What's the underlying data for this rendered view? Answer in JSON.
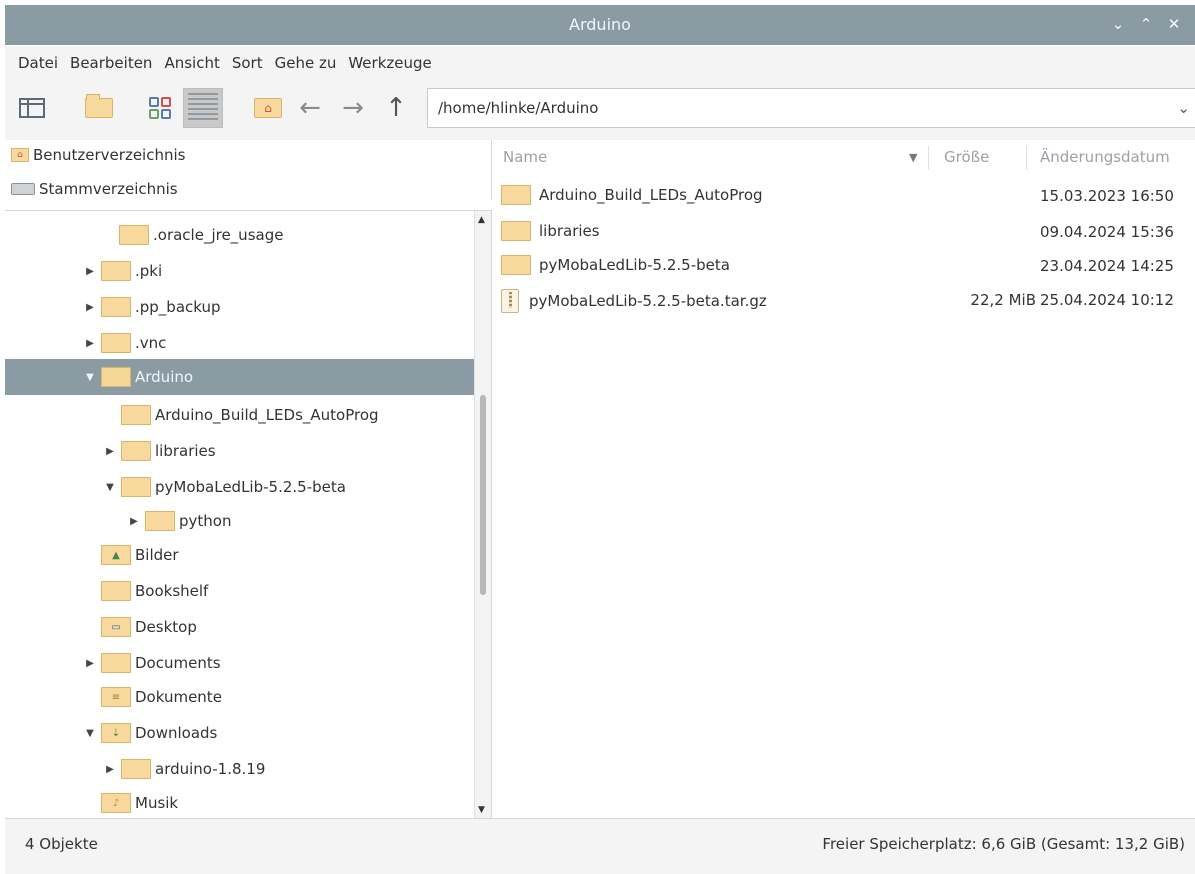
{
  "window": {
    "title": "Arduino"
  },
  "menu": [
    "Datei",
    "Bearbeiten",
    "Ansicht",
    "Sort",
    "Gehe zu",
    "Werkzeuge"
  ],
  "toolbar": {
    "path": "/home/hlinke/Arduino"
  },
  "places": [
    {
      "label": "Benutzerverzeichnis",
      "icon": "home-folder-icon"
    },
    {
      "label": "Stammverzeichnis",
      "icon": "drive-icon"
    }
  ],
  "tree": [
    {
      "label": ".oracle_jre_usage",
      "arrow": "",
      "selected": false
    },
    {
      "label": ".pki",
      "arrow": "▶",
      "selected": false
    },
    {
      "label": ".pp_backup",
      "arrow": "▶",
      "selected": false
    },
    {
      "label": ".vnc",
      "arrow": "▶",
      "selected": false
    },
    {
      "label": "Arduino",
      "arrow": "▼",
      "selected": true
    },
    {
      "label": "Arduino_Build_LEDs_AutoProg",
      "arrow": "",
      "selected": false
    },
    {
      "label": "libraries",
      "arrow": "▶",
      "selected": false
    },
    {
      "label": "pyMobaLedLib-5.2.5-beta",
      "arrow": "▼",
      "selected": false
    },
    {
      "label": "python",
      "arrow": "▶",
      "selected": false
    },
    {
      "label": "Bilder",
      "arrow": "",
      "selected": false
    },
    {
      "label": "Bookshelf",
      "arrow": "",
      "selected": false
    },
    {
      "label": "Desktop",
      "arrow": "",
      "selected": false
    },
    {
      "label": "Documents",
      "arrow": "▶",
      "selected": false
    },
    {
      "label": "Dokumente",
      "arrow": "",
      "selected": false
    },
    {
      "label": "Downloads",
      "arrow": "▼",
      "selected": false
    },
    {
      "label": "arduino-1.8.19",
      "arrow": "▶",
      "selected": false
    },
    {
      "label": "Musik",
      "arrow": "",
      "selected": false
    }
  ],
  "columns": {
    "name": "Name",
    "size": "Größe",
    "date": "Änderungsdatum"
  },
  "files": [
    {
      "name": "Arduino_Build_LEDs_AutoProg",
      "size": "",
      "date": "15.03.2023 16:50",
      "kind": "folder"
    },
    {
      "name": "libraries",
      "size": "",
      "date": "09.04.2024 15:36",
      "kind": "folder"
    },
    {
      "name": "pyMobaLedLib-5.2.5-beta",
      "size": "",
      "date": "23.04.2024 14:25",
      "kind": "folder"
    },
    {
      "name": "pyMobaLedLib-5.2.5-beta.tar.gz",
      "size": "22,2 MiB",
      "date": "25.04.2024 10:12",
      "kind": "archive"
    }
  ],
  "status": {
    "count": "4 Objekte",
    "free": "Freier Speicherplatz: 6,6 GiB (Gesamt: 13,2 GiB)"
  },
  "colors": {
    "titlebar": "#8a9ba4",
    "selection": "#8a9ba4",
    "folder": "#f7d89d"
  }
}
